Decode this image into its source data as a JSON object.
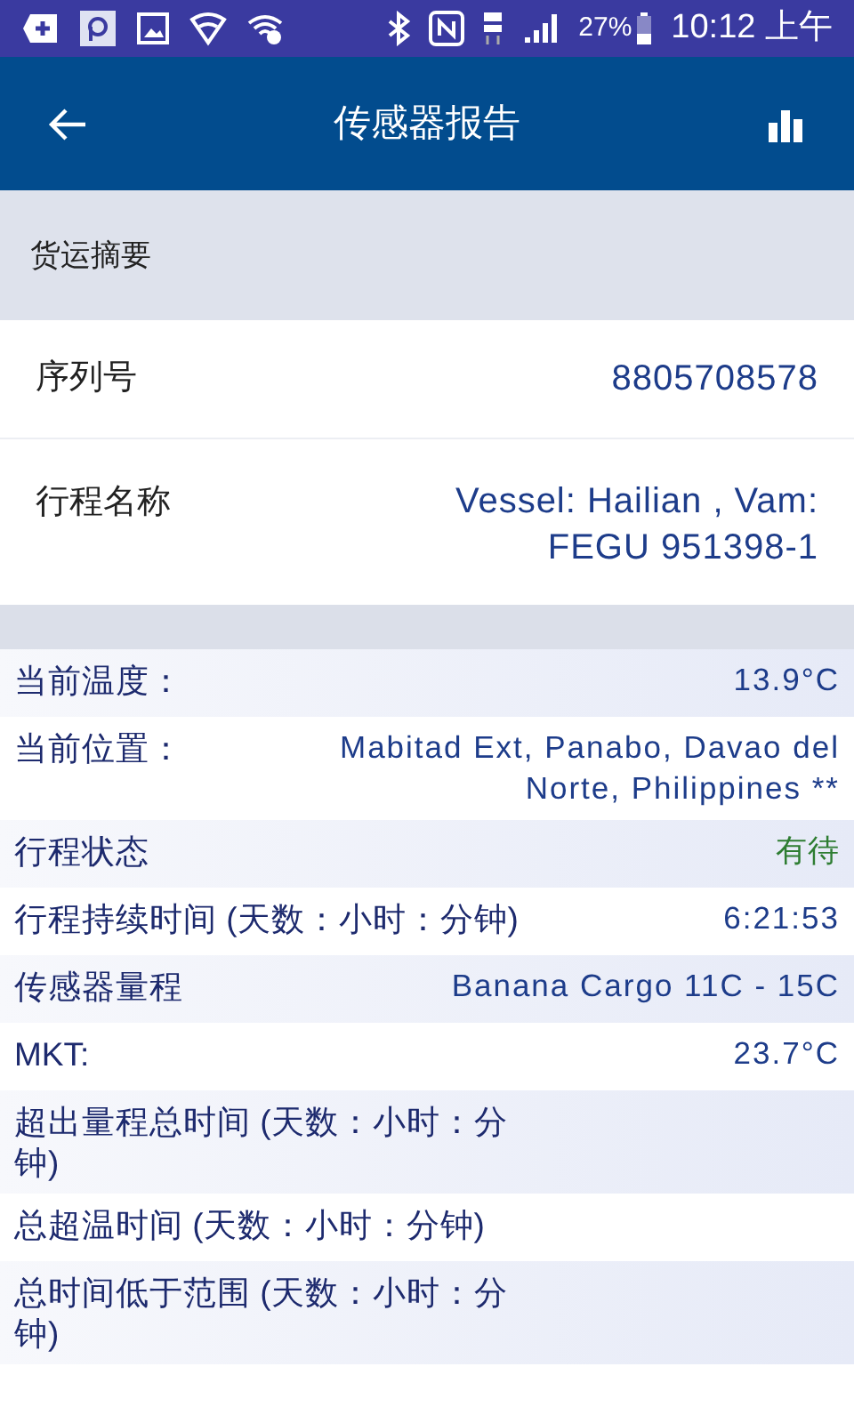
{
  "status_bar": {
    "battery": "27%",
    "time": "10:12 上午"
  },
  "app_bar": {
    "title": "传感器报告"
  },
  "shipment_summary": {
    "heading": "货运摘要",
    "rows": [
      {
        "label": "序列号",
        "value": "8805708578"
      },
      {
        "label": "行程名称",
        "value": "Vessel: Hailian , Vam: FEGU 951398-1"
      }
    ]
  },
  "details": [
    {
      "label": "当前温度：",
      "value": "13.9°C",
      "kind": "text"
    },
    {
      "label": "当前位置：",
      "value": "Mabitad Ext, Panabo, Davao del Norte, Philippines **",
      "kind": "text"
    },
    {
      "label": "行程状态",
      "value": "有待",
      "kind": "status"
    },
    {
      "label": "行程持续时间 (天数：小时：分钟)",
      "value": "6:21:53",
      "kind": "text"
    },
    {
      "label": "传感器量程",
      "value": "Banana Cargo 11C - 15C",
      "kind": "text"
    },
    {
      "label": "MKT:",
      "value": "23.7°C",
      "kind": "text"
    },
    {
      "label": "超出量程总时间 (天数：小时：分钟)"
    },
    {
      "label": "总超温时间 (天数：小时：分钟)"
    },
    {
      "label": "总时间低于范围 (天数：小时：分钟)"
    }
  ]
}
